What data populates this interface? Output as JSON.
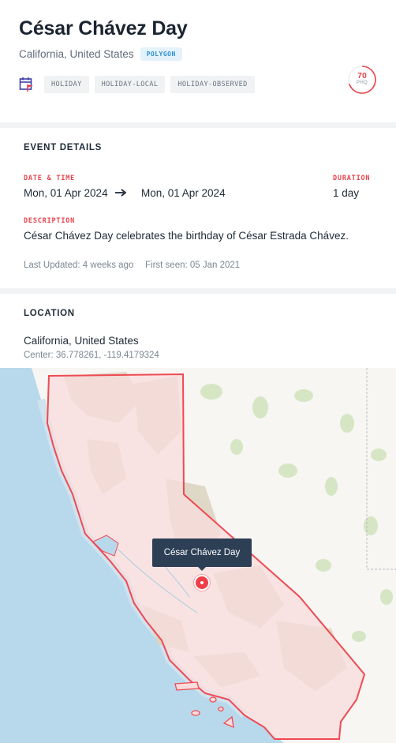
{
  "event": {
    "title": "César Chávez Day",
    "location": "California, United States",
    "location_type_badge": "POLYGON",
    "tags": [
      "HOLIDAY",
      "HOLIDAY-LOCAL",
      "HOLIDAY-OBSERVED"
    ],
    "phq_score": "70",
    "phq_label": "PHQ",
    "phq_fraction": 0.7,
    "category_icon": "calendar-flag-icon"
  },
  "details": {
    "section_title": "EVENT DETAILS",
    "date_time_label": "DATE & TIME",
    "start": "Mon, 01 Apr 2024",
    "end": "Mon, 01 Apr 2024",
    "duration_label": "DURATION",
    "duration": "1 day",
    "description_label": "DESCRIPTION",
    "description": "César Chávez Day celebrates the birthday of César Estrada Chávez.",
    "last_updated": "Last Updated: 4 weeks ago",
    "first_seen": "First seen: 05 Jan 2021"
  },
  "location_section": {
    "section_title": "LOCATION",
    "name": "California, United States",
    "center": "Center: 36.778261, -119.4179324"
  },
  "map": {
    "tooltip": "César Chávez Day",
    "colors": {
      "ocean": "#b8d8ec",
      "land": "#f7f6f3",
      "polygon_fill": "#f9dcdc",
      "polygon_stroke": "#ef4a52",
      "terrain": "#dcd3bf",
      "forest": "#d6e6c4",
      "marker": "#ee3e47"
    }
  },
  "colors": {
    "accent": "#e8434b",
    "badge_blue": "#2d8fd6",
    "tooltip_bg": "#2c3f55"
  }
}
